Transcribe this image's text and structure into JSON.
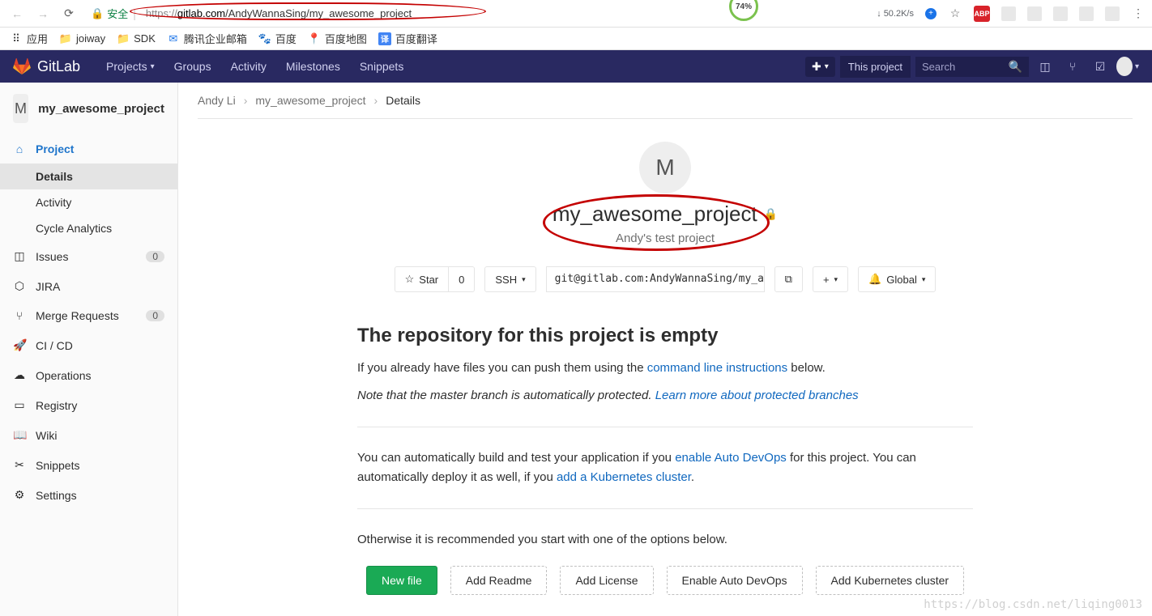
{
  "browser": {
    "secure_label": "安全",
    "url_prefix": "https://",
    "url_host": "gitlab.com",
    "url_path": "/AndyWannaSing/my_awesome_project",
    "badge_pct": "74%",
    "speed": "50.2K/s",
    "abp": "ABP"
  },
  "bookmarks": [
    {
      "label": "应用",
      "icon": "apps"
    },
    {
      "label": "joiway",
      "icon": "folder"
    },
    {
      "label": "SDK",
      "icon": "folder"
    },
    {
      "label": "腾讯企业邮箱",
      "icon": "mail"
    },
    {
      "label": "百度",
      "icon": "paw"
    },
    {
      "label": "百度地图",
      "icon": "pin"
    },
    {
      "label": "百度翻译",
      "icon": "translate"
    }
  ],
  "nav": {
    "brand": "GitLab",
    "items": [
      "Projects",
      "Groups",
      "Activity",
      "Milestones",
      "Snippets"
    ],
    "scope": "This project",
    "search_placeholder": "Search"
  },
  "sidebar": {
    "avatar_letter": "M",
    "project_name": "my_awesome_project",
    "items": [
      {
        "label": "Project",
        "sub": [
          "Details",
          "Activity",
          "Cycle Analytics"
        ]
      },
      {
        "label": "Issues",
        "badge": "0"
      },
      {
        "label": "JIRA"
      },
      {
        "label": "Merge Requests",
        "badge": "0"
      },
      {
        "label": "CI / CD"
      },
      {
        "label": "Operations"
      },
      {
        "label": "Registry"
      },
      {
        "label": "Wiki"
      },
      {
        "label": "Snippets"
      },
      {
        "label": "Settings"
      }
    ]
  },
  "breadcrumbs": {
    "a": "Andy Li",
    "b": "my_awesome_project",
    "c": "Details"
  },
  "project": {
    "avatar_letter": "M",
    "title": "my_awesome_project",
    "description": "Andy's test project",
    "star_label": "Star",
    "star_count": "0",
    "protocol": "SSH",
    "clone_url": "git@gitlab.com:AndyWannaSing/my_aw",
    "notif_label": "Global"
  },
  "empty": {
    "heading": "The repository for this project is empty",
    "p1_a": "If you already have files you can push them using the ",
    "p1_link": "command line instructions",
    "p1_b": " below.",
    "p2_a": "Note that the master branch is automatically protected. ",
    "p2_link": "Learn more about protected branches",
    "p3_a": "You can automatically build and test your application if you ",
    "p3_link1": "enable Auto DevOps",
    "p3_b": " for this project. You can automatically deploy it as well, if you ",
    "p3_link2": "add a Kubernetes cluster",
    "p3_c": ".",
    "p4": "Otherwise it is recommended you start with one of the options below."
  },
  "quick": [
    "New file",
    "Add Readme",
    "Add License",
    "Enable Auto DevOps",
    "Add Kubernetes cluster"
  ],
  "watermark": "https://blog.csdn.net/liqing0013"
}
